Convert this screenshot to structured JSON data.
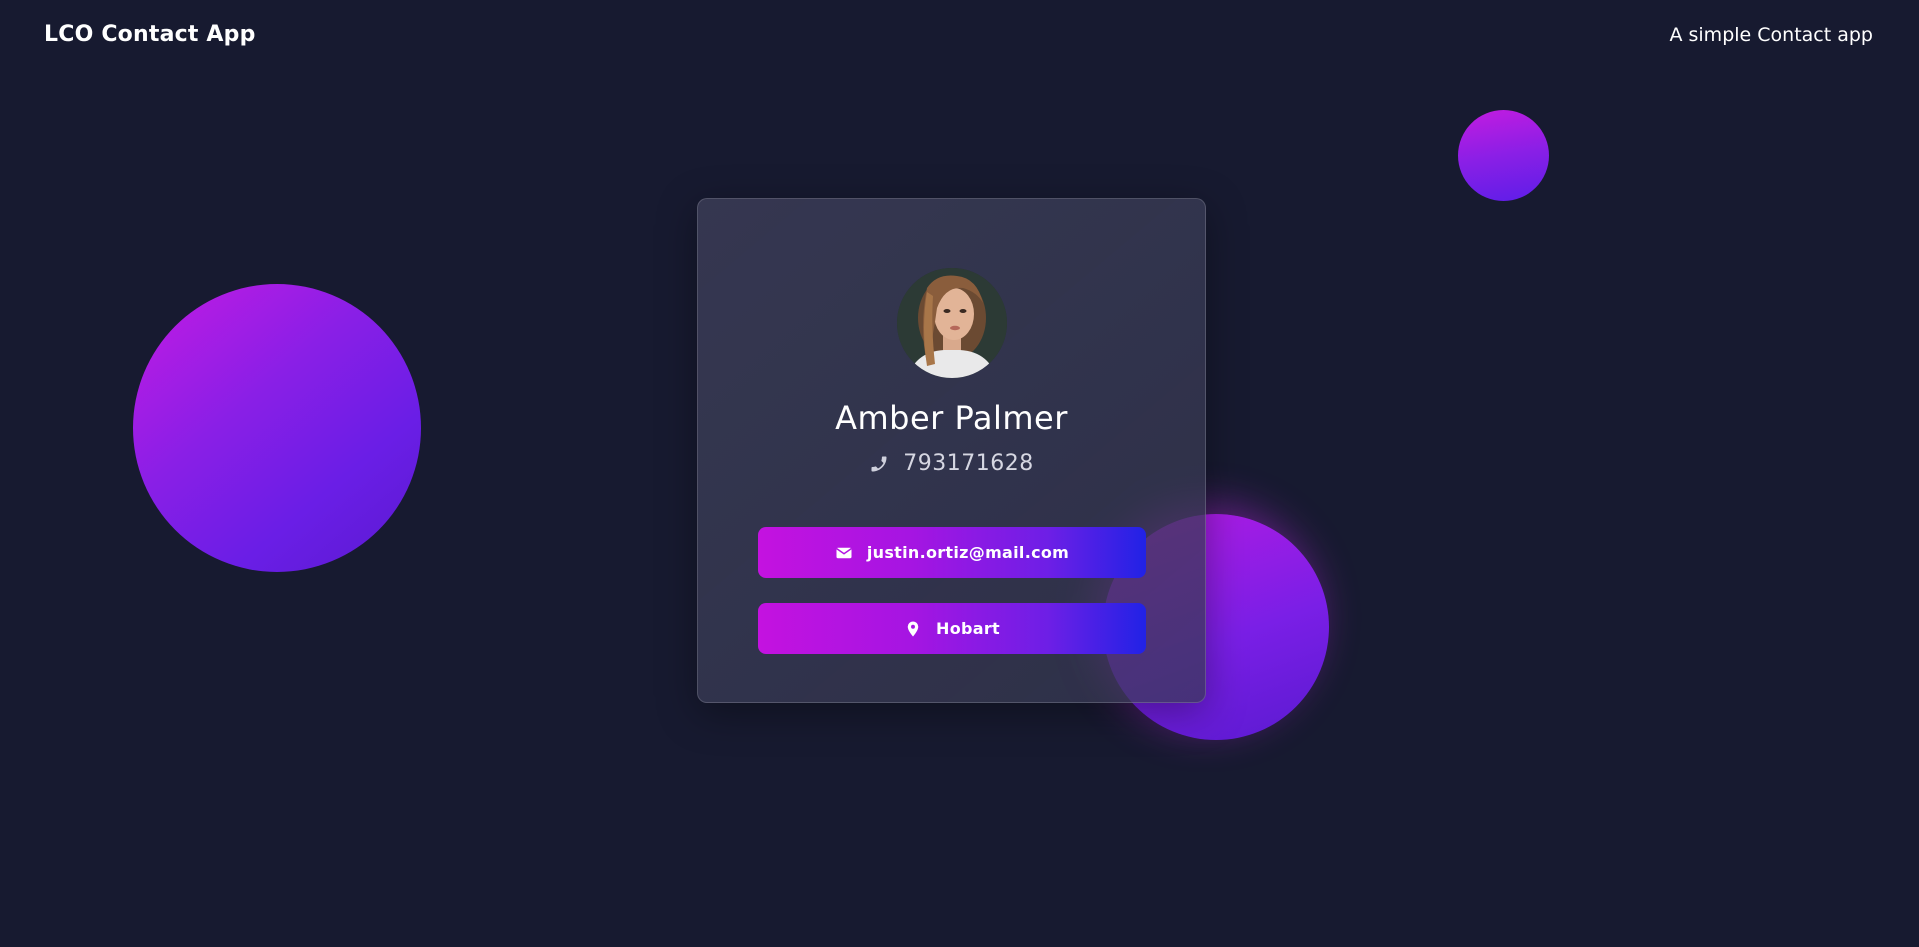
{
  "header": {
    "brand": "LCO Contact App",
    "tagline": "A simple Contact app"
  },
  "contact": {
    "name": "Amber Palmer",
    "phone": "793171628",
    "email": "justin.ortiz@mail.com",
    "location": "Hobart",
    "avatar": "avatar-photo"
  },
  "icons": {
    "phone": "phone-icon",
    "email": "envelope-icon",
    "location": "map-pin-icon"
  },
  "colors": {
    "background": "#171a30",
    "gradient_start": "#c412e0",
    "gradient_end": "#2122e6",
    "orb_purple": "#8a1fe6"
  }
}
